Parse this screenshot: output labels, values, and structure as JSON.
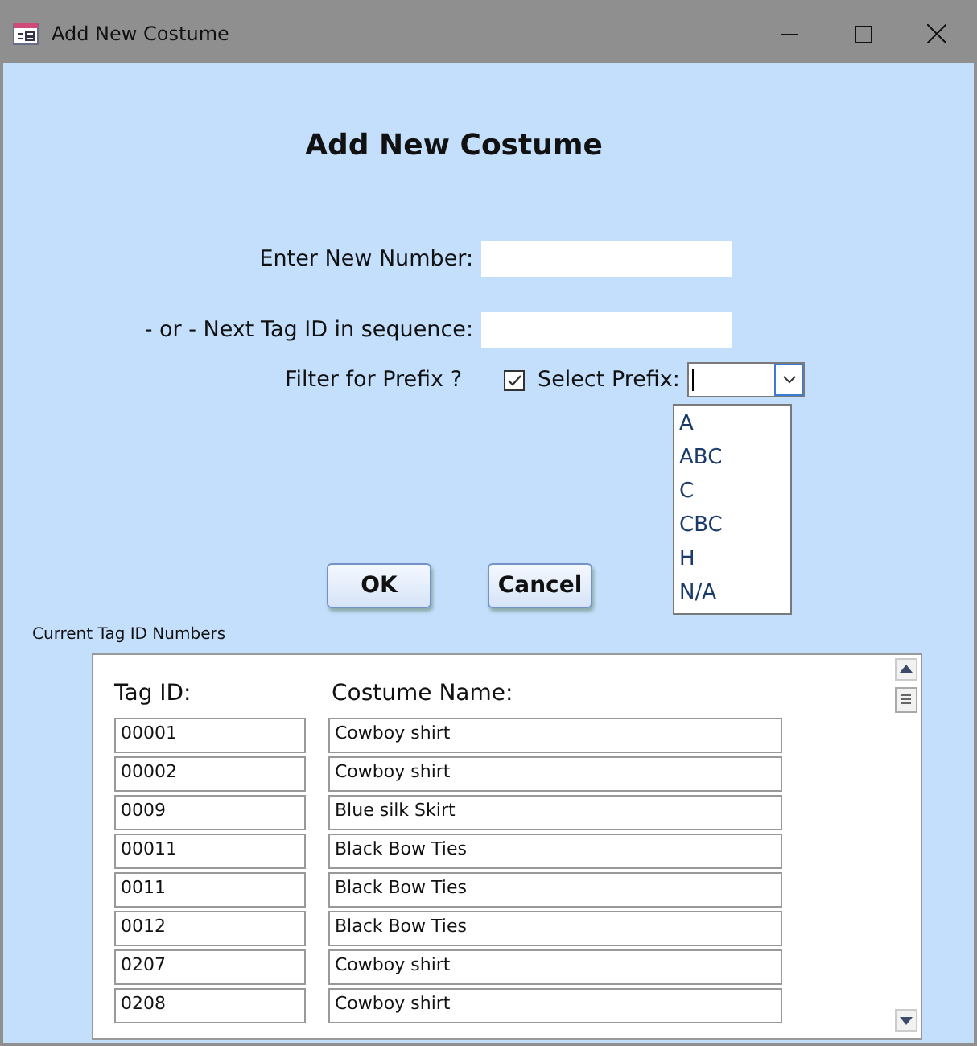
{
  "window": {
    "title": "Add New Costume"
  },
  "heading": "Add New Costume",
  "fields": [
    {
      "label": "Enter New Number:"
    },
    {
      "label": "- or - Next Tag ID in sequence:"
    }
  ],
  "filter": {
    "label": "Filter for Prefix ?",
    "checked": true
  },
  "prefix_combo": {
    "label": "Select Prefix:",
    "expanded": true,
    "options": [
      {
        "text": "A",
        "selected": false
      },
      {
        "text": "ABC",
        "selected": false
      },
      {
        "text": "C",
        "selected": false
      },
      {
        "text": "CBC",
        "selected": false
      },
      {
        "text": "H",
        "selected": false
      },
      {
        "text": "N/A",
        "selected": false
      }
    ]
  },
  "buttons": [
    "OK",
    "Cancel"
  ],
  "subform": {
    "caption": "Current Tag ID Numbers",
    "columns": [
      "Tag ID:",
      "Costume Name:"
    ],
    "rows": [
      {
        "tag_id": "00001",
        "name": "Cowboy shirt"
      },
      {
        "tag_id": "00002",
        "name": "Cowboy shirt"
      },
      {
        "tag_id": "0009",
        "name": "Blue silk Skirt"
      },
      {
        "tag_id": "00011",
        "name": "Black Bow Ties"
      },
      {
        "tag_id": "0011",
        "name": "Black Bow Ties"
      },
      {
        "tag_id": "0012",
        "name": "Black Bow Ties"
      },
      {
        "tag_id": "0207",
        "name": "Cowboy shirt"
      },
      {
        "tag_id": "0208",
        "name": "Cowboy shirt"
      }
    ]
  }
}
